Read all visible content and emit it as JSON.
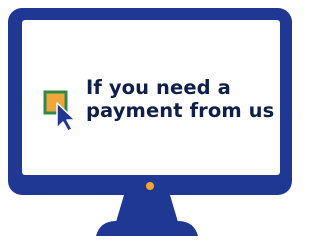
{
  "headline": {
    "line1": "If you need a",
    "line2": "payment from us"
  },
  "icons": {
    "cursor": "mouse-pointer-icon",
    "box": "square-icon"
  },
  "colors": {
    "frame": "#1f3893",
    "screen": "#ffffff",
    "accent": "#f5a623",
    "box_fill": "#f0a63a",
    "box_border": "#2a8a4a",
    "text": "#101e4a"
  }
}
